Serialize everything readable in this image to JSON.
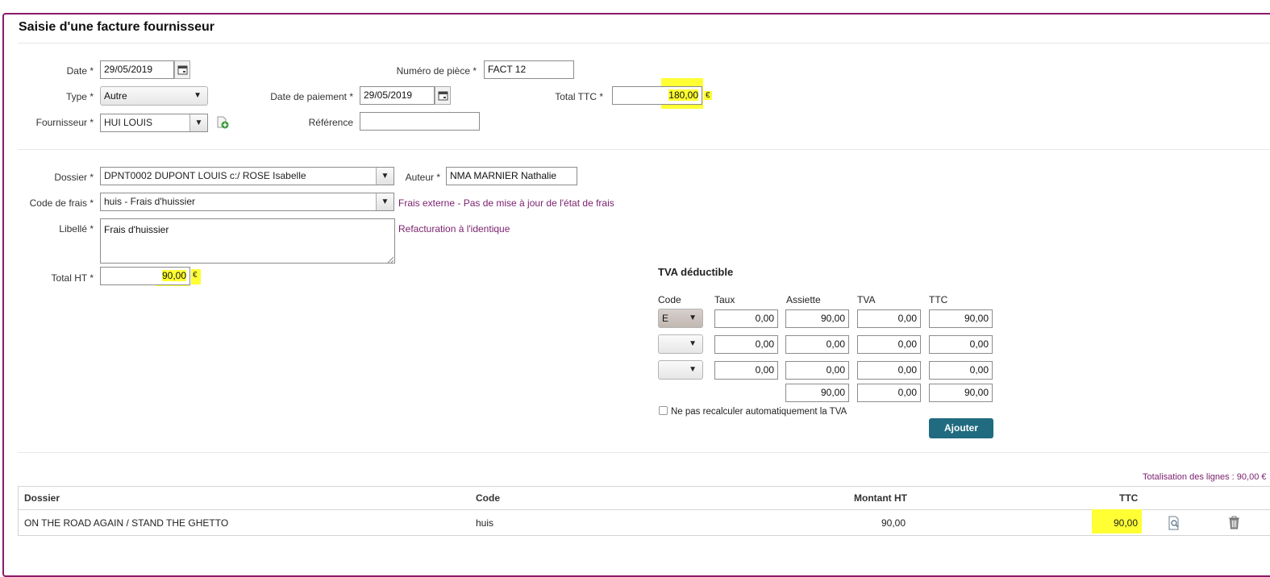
{
  "page": {
    "title": "Saisie d'une facture fournisseur"
  },
  "header": {
    "date_label": "Date *",
    "date_value": "29/05/2019",
    "type_label": "Type *",
    "type_value": "Autre",
    "fournisseur_label": "Fournisseur *",
    "fournisseur_value": "HUI LOUIS",
    "numero_label": "Numéro de pièce *",
    "numero_value": "FACT 12",
    "date_paiement_label": "Date de paiement *",
    "date_paiement_value": "29/05/2019",
    "reference_label": "Référence",
    "reference_value": "",
    "total_ttc_label": "Total TTC *",
    "total_ttc_value": "180,00",
    "currency": "€"
  },
  "line": {
    "dossier_label": "Dossier *",
    "dossier_value": "DPNT0002 DUPONT LOUIS c:/ ROSE Isabelle",
    "auteur_label": "Auteur *",
    "auteur_value": "NMA MARNIER Nathalie",
    "code_frais_label": "Code de frais *",
    "code_frais_value": "huis - Frais d'huissier",
    "code_frais_info": "Frais externe - Pas de mise à jour de l'état de frais",
    "libelle_label": "Libellé *",
    "libelle_value": "Frais d'huissier",
    "libelle_info": "Refacturation à l'identique",
    "total_ht_label": "Total HT *",
    "total_ht_value": "90,00",
    "currency": "€"
  },
  "tva": {
    "title": "TVA déductible",
    "headers": [
      "Code",
      "Taux",
      "Assiette",
      "TVA",
      "TTC"
    ],
    "rows": [
      {
        "code": "E",
        "taux": "0,00",
        "assiette": "90,00",
        "tva": "0,00",
        "ttc": "90,00"
      },
      {
        "code": "",
        "taux": "0,00",
        "assiette": "0,00",
        "tva": "0,00",
        "ttc": "0,00"
      },
      {
        "code": "",
        "taux": "0,00",
        "assiette": "0,00",
        "tva": "0,00",
        "ttc": "0,00"
      }
    ],
    "totals": {
      "assiette": "90,00",
      "tva": "0,00",
      "ttc": "90,00"
    },
    "no_recalc_label": "Ne pas recalculer automatiquement la TVA",
    "add_button": "Ajouter"
  },
  "summary": {
    "totalisation": "Totalisation des lignes : 90,00 €"
  },
  "table": {
    "headers": {
      "dossier": "Dossier",
      "code": "Code",
      "montant_ht": "Montant HT",
      "ttc": "TTC"
    },
    "rows": [
      {
        "dossier": "ON THE ROAD AGAIN / STAND THE GHETTO",
        "code": "huis",
        "montant_ht": "90,00",
        "ttc": "90,00"
      }
    ]
  },
  "colors": {
    "accent": "#216b80",
    "frame": "#8e1a67",
    "info": "#7a1f6d",
    "highlight": "#ffff33"
  }
}
